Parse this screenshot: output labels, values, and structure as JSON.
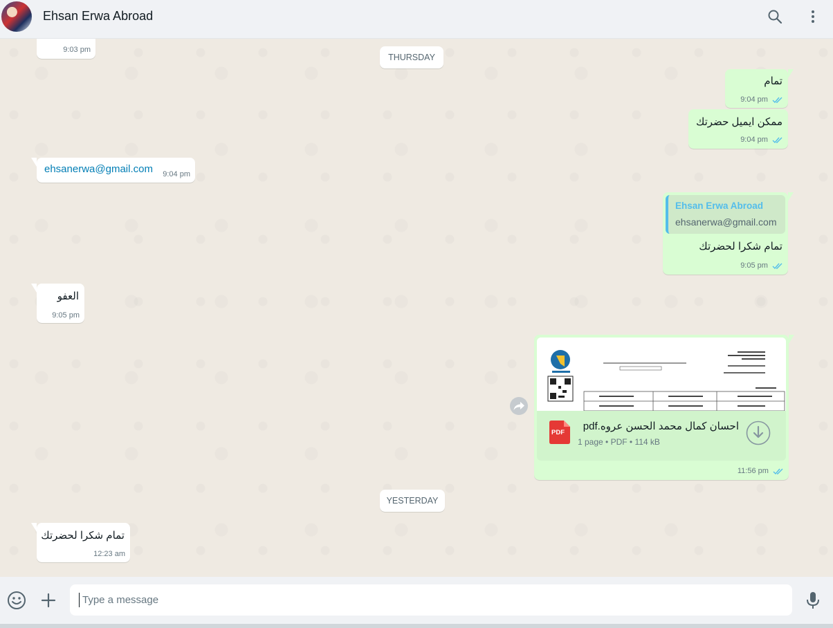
{
  "header": {
    "contact_name": "Ehsan Erwa Abroad",
    "search_icon": "search-icon",
    "menu_icon": "kebab-menu-icon"
  },
  "chat": {
    "top_partial_time": "9:03 pm",
    "day_thursday": "THURSDAY",
    "day_yesterday": "YESTERDAY",
    "messages": [
      {
        "dir": "out",
        "text": "تمام",
        "time": "9:04 pm",
        "status": "read"
      },
      {
        "dir": "out",
        "text": "ممكن ايميل حضرتك",
        "time": "9:04 pm",
        "status": "read"
      },
      {
        "dir": "in",
        "text": "ehsanerwa@gmail.com",
        "time": "9:04 pm"
      },
      {
        "dir": "out",
        "quote_author": "Ehsan Erwa Abroad",
        "quote_text": "ehsanerwa@gmail.com",
        "text": "تمام شكرا لحضرتك",
        "time": "9:05 pm",
        "status": "read"
      },
      {
        "dir": "in",
        "text": "العفو",
        "time": "9:05 pm"
      },
      {
        "dir": "out",
        "type": "document",
        "file_name": "احسان كمال محمد الحسن عروه.pdf",
        "file_icon_label": "PDF",
        "meta_pages": "1 page",
        "meta_type": "PDF",
        "meta_size": "114 kB",
        "time": "11:56 pm",
        "status": "read"
      },
      {
        "dir": "in",
        "text": "تمام شكرا لحضرتك",
        "time": "12:23 am"
      }
    ]
  },
  "composer": {
    "placeholder": "Type a message",
    "emoji_icon": "emoji-icon",
    "attach_icon": "plus-icon",
    "mic_icon": "microphone-icon"
  },
  "colors": {
    "chat_bg": "#efeae2",
    "outgoing_bubble": "#d9fdd3",
    "incoming_bubble": "#ffffff",
    "read_ticks": "#53bdeb",
    "link": "#027eb5",
    "quote_author": "#53bdeb"
  }
}
